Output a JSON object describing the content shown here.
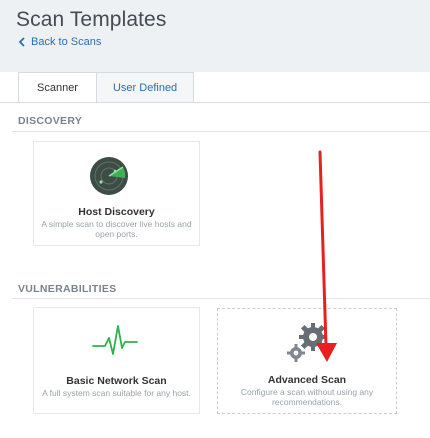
{
  "header": {
    "title": "Scan Templates",
    "back_link_label": "Back to Scans"
  },
  "tabs": [
    {
      "label": "Scanner",
      "active": true
    },
    {
      "label": "User Defined",
      "active": false
    }
  ],
  "sections": {
    "discovery": {
      "label": "DISCOVERY",
      "cards": [
        {
          "title": "Host Discovery",
          "description": "A simple scan to discover live hosts and open ports.",
          "icon": "radar-icon"
        }
      ]
    },
    "vulnerabilities": {
      "label": "VULNERABILITIES",
      "cards": [
        {
          "title": "Basic Network Scan",
          "description": "A full system scan suitable for any host.",
          "icon": "heartbeat-icon"
        },
        {
          "title": "Advanced Scan",
          "description": "Configure a scan without using any recommendations.",
          "icon": "gears-icon"
        }
      ]
    }
  },
  "colors": {
    "link": "#2a6fb0",
    "accent_green": "#2bb24c",
    "annotation_red": "#e8201f",
    "header_background": "#eef1f4"
  }
}
